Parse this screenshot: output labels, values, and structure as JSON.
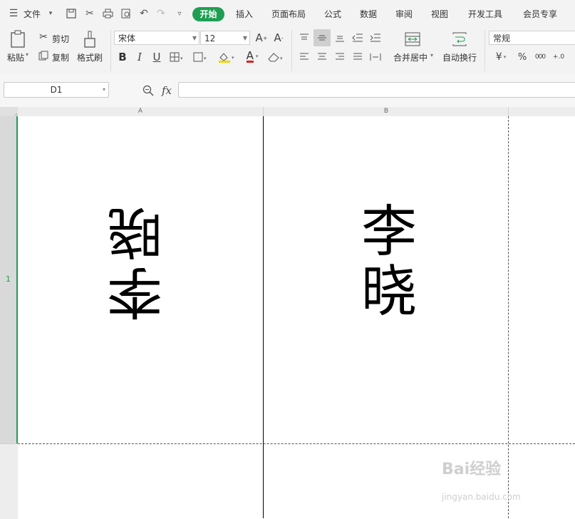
{
  "menubar": {
    "file_label": "文件",
    "tabs": [
      {
        "label": "开始",
        "active": true
      },
      {
        "label": "插入"
      },
      {
        "label": "页面布局"
      },
      {
        "label": "公式"
      },
      {
        "label": "数据"
      },
      {
        "label": "审阅"
      },
      {
        "label": "视图"
      },
      {
        "label": "开发工具"
      },
      {
        "label": "会员专享"
      }
    ]
  },
  "ribbon": {
    "paste_label": "粘贴",
    "cut_label": "剪切",
    "copy_label": "复制",
    "format_painter_label": "格式刷",
    "font_name": "宋体",
    "font_size": "12",
    "merge_label": "合并居中",
    "wrap_label": "自动换行",
    "number_format": "常规",
    "bold": "B",
    "italic": "I",
    "underline": "U",
    "font_color_glyph": "A",
    "currency_glyph": "¥",
    "percent_glyph": "%",
    "thousands_glyph": "000",
    "inc_dec_glyph": "+.0"
  },
  "formula_bar": {
    "cell_ref": "D1",
    "fx_label": "fx",
    "value": ""
  },
  "sheet": {
    "columns": [
      "A",
      "B"
    ],
    "rows": [
      "1"
    ],
    "cells": {
      "A1": "李晓",
      "B1": "李晓"
    }
  },
  "watermark": {
    "line1": "Bai经验",
    "line2": "jingyan.baidu.com"
  },
  "colors": {
    "accent": "#1e9e52",
    "menubar_bg": "#f3f3f3"
  }
}
